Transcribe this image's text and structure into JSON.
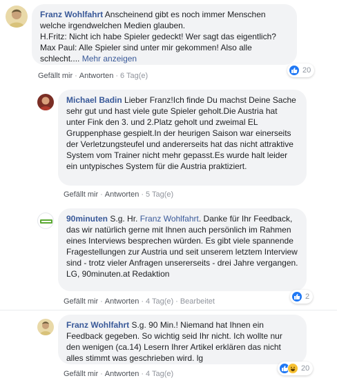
{
  "comments": [
    {
      "author": "Franz Wohlfahrt",
      "text": "Anscheinend gibt es noch immer Menschen welche irgendwelchen Medien glauben.\nH.Fritz: Nicht ich habe Spieler gedeckt! Wer sagt das eigentlich?\nMax Paul: Alle Spieler sind unter mir gekommen! Also alle schlecht....",
      "more_link": "Mehr anzeigen",
      "like_label": "Gefällt mir",
      "reply_label": "Antworten",
      "time": "6 Tag(e)",
      "reaction_count": "20"
    },
    {
      "author": "Michael Badin",
      "text": "Lieber Franz!Ich finde Du machst Deine Sache sehr gut und hast viele gute Spieler geholt.Die Austria hat unter Fink den 3. und 2.Platz geholt und zweimal EL Gruppenphase gespielt.In der heurigen Saison war einerseits der Verletzungsteufel und andererseits hat das nicht attraktive System vom Trainer nicht mehr gepasst.Es wurde halt leider ein untypisches System für die Austria praktiziert.",
      "like_label": "Gefällt mir",
      "reply_label": "Antworten",
      "time": "5 Tag(e)"
    },
    {
      "author": "90minuten",
      "text_before": "S.g. Hr. ",
      "mention": "Franz Wohlfahrt",
      "text_after": ". Danke für Ihr Feedback, das wir natürlich gerne mit Ihnen auch persönlich im Rahmen eines Interviews besprechen würden. Es gibt viele spannende Fragestellungen zur Austria und seit unserem letztem Interview sind - trotz vieler Anfragen unsererseits - drei Jahre vergangen. LG, 90minuten.at Redaktion",
      "logo_text": "90minuten",
      "like_label": "Gefällt mir",
      "reply_label": "Antworten",
      "time": "4 Tag(e)",
      "edited": "Bearbeitet",
      "reaction_count": "2"
    },
    {
      "author": "Franz Wohlfahrt",
      "text": "S.g. 90 Min.! Niemand hat Ihnen ein Feedback gegeben. So wichtig seid Ihr nicht. Ich wollte nur den wenigen (ca.14) Lesern Ihrer Artikel erklären das nicht alles stimmt was geschrieben wird. lg",
      "like_label": "Gefällt mir",
      "reply_label": "Antworten",
      "time": "4 Tag(e)",
      "reaction_count": "20"
    }
  ],
  "colors": {
    "link": "#385898",
    "bubble": "#f2f3f5",
    "like_blue": "#2078f4",
    "haha_yellow": "#f7c133"
  }
}
